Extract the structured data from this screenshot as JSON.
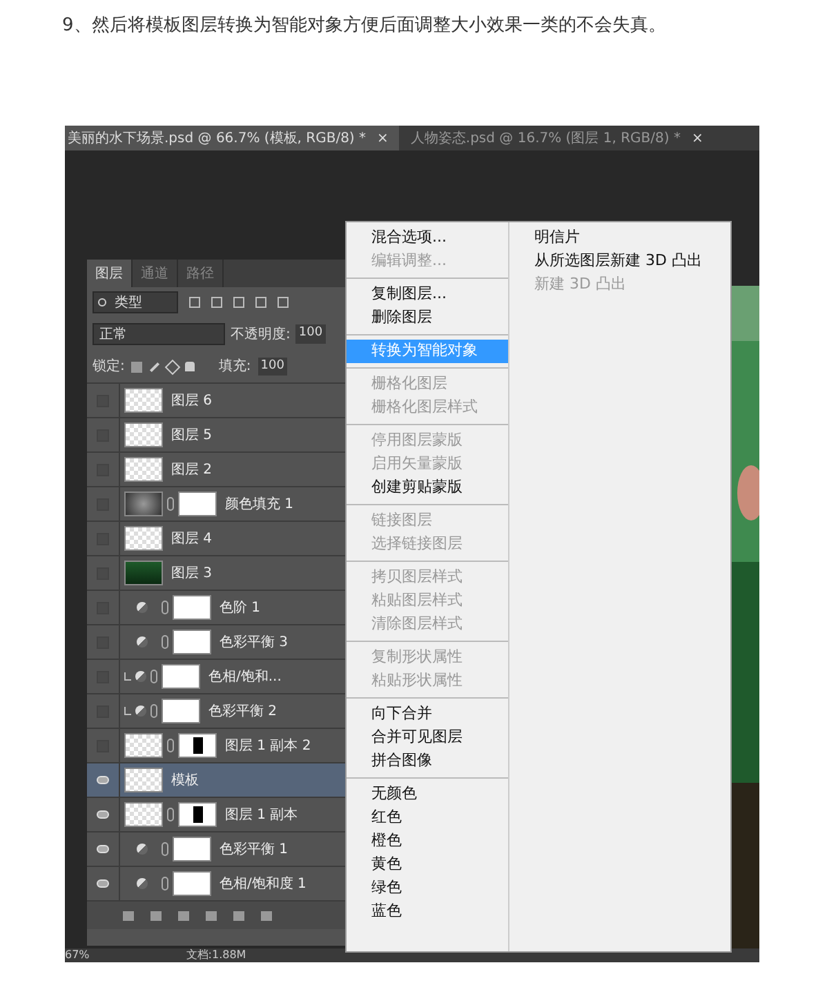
{
  "article": {
    "step_text": "9、然后将模板图层转换为智能对象方便后面调整大小效果一类的不会失真。"
  },
  "document_tabs": [
    {
      "label": "美丽的水下场景.psd @ 66.7% (模板, RGB/8) *",
      "close": "×",
      "selected": true
    },
    {
      "label": "人物姿态.psd @ 16.7% (图层 1, RGB/8) *",
      "close": "×",
      "selected": false
    }
  ],
  "layers_panel": {
    "tabs": [
      {
        "label": "图层",
        "selected": true
      },
      {
        "label": "通道",
        "selected": false
      },
      {
        "label": "路径",
        "selected": false
      }
    ],
    "filter": "类型",
    "blend_mode": "正常",
    "opacity_label": "不透明度:",
    "opacity": "100",
    "lock_label": "锁定:",
    "fill_label": "填充:",
    "fill": "100",
    "layers": [
      {
        "name": "图层 6",
        "kind": "pixel",
        "visible": false,
        "selected": false
      },
      {
        "name": "图层 5",
        "kind": "pixel",
        "visible": false,
        "selected": false
      },
      {
        "name": "图层 2",
        "kind": "pixel",
        "visible": false,
        "selected": false
      },
      {
        "name": "颜色填充 1",
        "kind": "fill",
        "visible": false,
        "selected": false
      },
      {
        "name": "图层 4",
        "kind": "pixel",
        "visible": false,
        "selected": false
      },
      {
        "name": "图层 3",
        "kind": "green",
        "visible": false,
        "selected": false
      },
      {
        "name": "色阶 1",
        "kind": "adjustment",
        "visible": false,
        "selected": false
      },
      {
        "name": "色彩平衡 3",
        "kind": "adjustment",
        "visible": false,
        "selected": false
      },
      {
        "name": "色相/饱和...",
        "kind": "clipped",
        "visible": false,
        "selected": false
      },
      {
        "name": "色彩平衡 2",
        "kind": "clipped",
        "visible": false,
        "selected": false
      },
      {
        "name": "图层 1 副本 2",
        "kind": "masked",
        "visible": false,
        "selected": false
      },
      {
        "name": "模板",
        "kind": "pixel",
        "visible": true,
        "selected": true
      },
      {
        "name": "图层 1 副本",
        "kind": "masked",
        "visible": true,
        "selected": false
      },
      {
        "name": "色彩平衡 1",
        "kind": "adjustment",
        "visible": true,
        "selected": false
      },
      {
        "name": "色相/饱和度 1",
        "kind": "adjustment",
        "visible": true,
        "selected": false
      }
    ]
  },
  "context_menu": {
    "groups": [
      {
        "items": [
          {
            "label": "混合选项...",
            "disabled": false,
            "selected": false
          },
          {
            "label": "编辑调整...",
            "disabled": true,
            "selected": false
          }
        ]
      },
      {
        "items": [
          {
            "label": "复制图层...",
            "disabled": false,
            "selected": false
          },
          {
            "label": "删除图层",
            "disabled": false,
            "selected": false
          }
        ]
      },
      {
        "items": [
          {
            "label": "转换为智能对象",
            "disabled": false,
            "selected": true
          }
        ]
      },
      {
        "items": [
          {
            "label": "栅格化图层",
            "disabled": true,
            "selected": false
          },
          {
            "label": "栅格化图层样式",
            "disabled": true,
            "selected": false
          }
        ]
      },
      {
        "items": [
          {
            "label": "停用图层蒙版",
            "disabled": true,
            "selected": false
          },
          {
            "label": "启用矢量蒙版",
            "disabled": true,
            "selected": false
          },
          {
            "label": "创建剪贴蒙版",
            "disabled": false,
            "selected": false
          }
        ]
      },
      {
        "items": [
          {
            "label": "链接图层",
            "disabled": true,
            "selected": false
          },
          {
            "label": "选择链接图层",
            "disabled": true,
            "selected": false
          }
        ]
      },
      {
        "items": [
          {
            "label": "拷贝图层样式",
            "disabled": true,
            "selected": false
          },
          {
            "label": "粘贴图层样式",
            "disabled": true,
            "selected": false
          },
          {
            "label": "清除图层样式",
            "disabled": true,
            "selected": false
          }
        ]
      },
      {
        "items": [
          {
            "label": "复制形状属性",
            "disabled": true,
            "selected": false
          },
          {
            "label": "粘贴形状属性",
            "disabled": true,
            "selected": false
          }
        ]
      },
      {
        "items": [
          {
            "label": "向下合并",
            "disabled": false,
            "selected": false
          },
          {
            "label": "合并可见图层",
            "disabled": false,
            "selected": false
          },
          {
            "label": "拼合图像",
            "disabled": false,
            "selected": false
          }
        ]
      },
      {
        "items": [
          {
            "label": "无颜色",
            "disabled": false,
            "selected": false
          },
          {
            "label": "红色",
            "disabled": false,
            "selected": false
          },
          {
            "label": "橙色",
            "disabled": false,
            "selected": false
          },
          {
            "label": "黄色",
            "disabled": false,
            "selected": false
          },
          {
            "label": "绿色",
            "disabled": false,
            "selected": false
          },
          {
            "label": "蓝色",
            "disabled": false,
            "selected": false
          }
        ]
      }
    ],
    "side_items": [
      {
        "label": "明信片",
        "disabled": false
      },
      {
        "label": "从所选图层新建 3D 凸出",
        "disabled": false
      },
      {
        "label": "新建 3D 凸出",
        "disabled": true
      }
    ]
  },
  "status_bar": {
    "zoom": "67%",
    "doc_size": "文档:1.88M"
  }
}
